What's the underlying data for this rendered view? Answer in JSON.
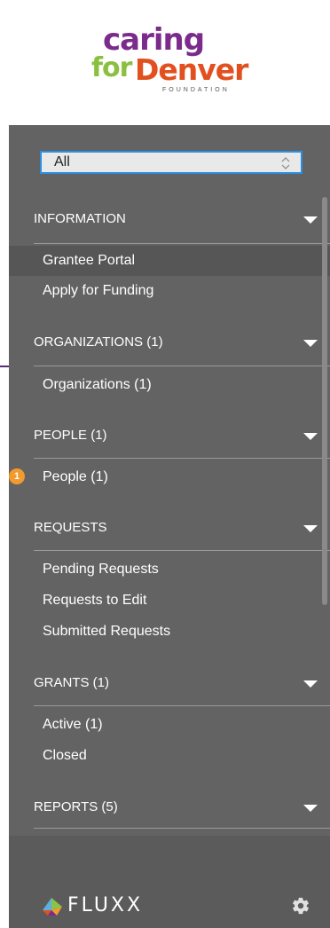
{
  "logo": {
    "line1": "caring",
    "for": "for",
    "denver": "Denver",
    "foundation": "FOUNDATION"
  },
  "filter": {
    "selected": "All"
  },
  "sections": [
    {
      "label": "INFORMATION",
      "items": [
        "Grantee Portal",
        "Apply for Funding"
      ]
    },
    {
      "label": "ORGANIZATIONS (1)",
      "items": [
        "Organizations  (1)"
      ]
    },
    {
      "label": "PEOPLE (1)",
      "items": [
        "People  (1)"
      ]
    },
    {
      "label": "REQUESTS",
      "items": [
        "Pending Requests",
        "Requests to Edit",
        "Submitted Requests"
      ]
    },
    {
      "label": "GRANTS (1)",
      "items": [
        "Active  (1)",
        "Closed"
      ]
    },
    {
      "label": "REPORTS (5)",
      "items": []
    }
  ],
  "notification_badge": "1",
  "footer": {
    "brand": "FLUXX"
  },
  "colors": {
    "panel": "#636363",
    "badge": "#f29a2e",
    "select_border": "#2c8fe0"
  }
}
